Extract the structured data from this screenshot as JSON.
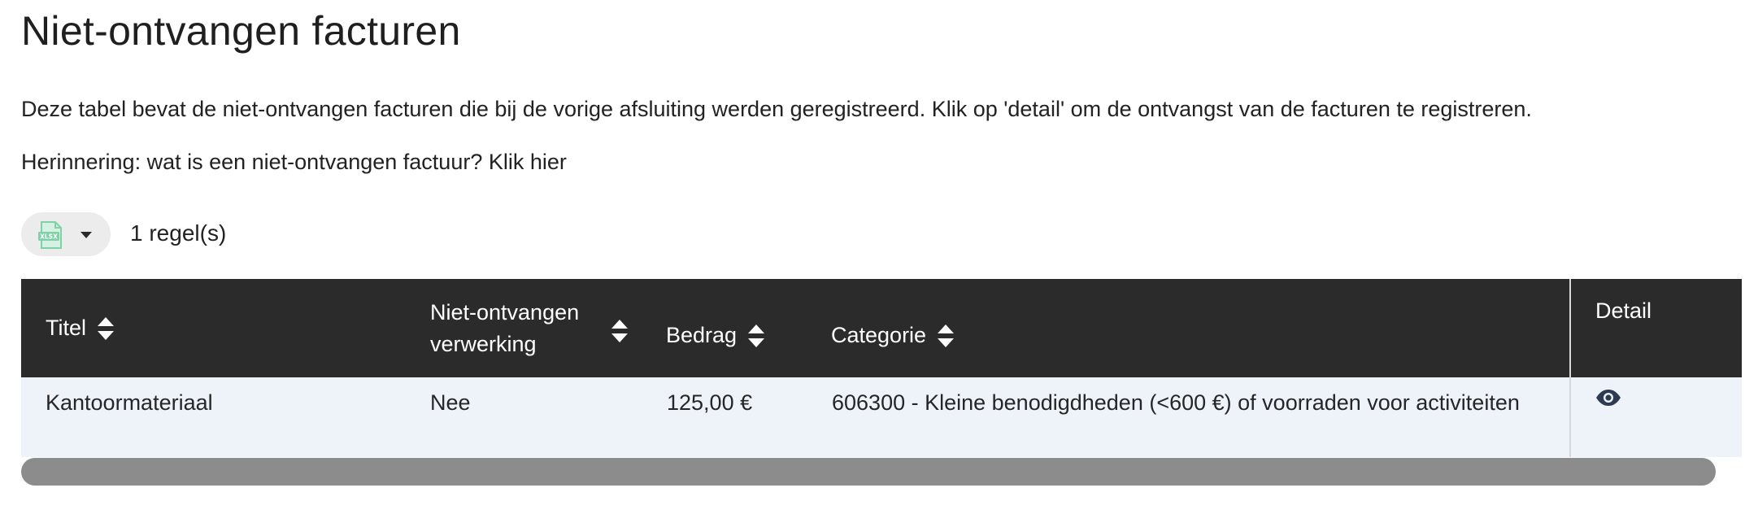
{
  "page": {
    "title": "Niet-ontvangen facturen",
    "description": "Deze tabel bevat de niet-ontvangen facturen die bij de vorige afsluiting werden geregistreerd. Klik op 'detail' om de ontvangst van de facturen te registreren.",
    "reminder": "Herinnering: wat is een niet-ontvangen factuur? Klik hier"
  },
  "toolbar": {
    "export_icon": "xlsx-file-icon",
    "dropdown_icon": "caret-down-icon",
    "row_count": "1 regel(s)"
  },
  "table": {
    "headers": {
      "titel": "Titel",
      "verwerking_line1": "Niet-ontvangen",
      "verwerking_line2": "verwerking",
      "bedrag": "Bedrag",
      "categorie": "Categorie",
      "detail": "Detail"
    },
    "rows": [
      {
        "titel": "Kantoormateriaal",
        "verwerking": "Nee",
        "bedrag": "125,00 €",
        "categorie": "606300 - Kleine benodigdheden (<600 €) of voorraden voor activiteiten",
        "detail_icon": "eye-icon"
      }
    ]
  },
  "colors": {
    "header_bg": "#2b2b2b",
    "row_bg": "#eef3fa",
    "scrollbar": "#8c8c8c",
    "excel_green": "#7fd1a6"
  }
}
